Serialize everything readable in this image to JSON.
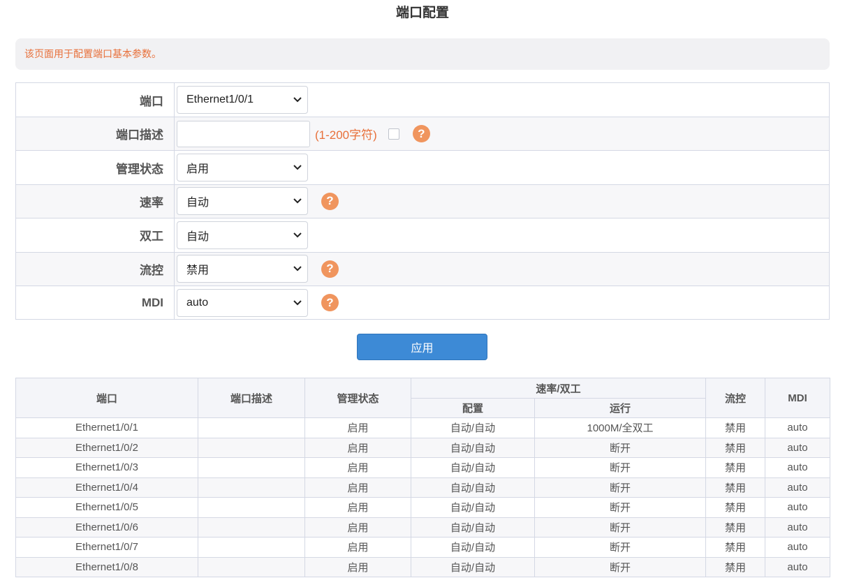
{
  "page": {
    "title": "端口配置",
    "notice": "该页面用于配置端口基本参数。"
  },
  "form": {
    "port": {
      "label": "端口",
      "value": "Ethernet1/0/1"
    },
    "description": {
      "label": "端口描述",
      "value": "",
      "hint": "(1-200字符)"
    },
    "admin_status": {
      "label": "管理状态",
      "value": "启用"
    },
    "speed": {
      "label": "速率",
      "value": "自动"
    },
    "duplex": {
      "label": "双工",
      "value": "自动"
    },
    "flow_control": {
      "label": "流控",
      "value": "禁用"
    },
    "mdi": {
      "label": "MDI",
      "value": "auto"
    },
    "help_glyph": "?",
    "apply_label": "应用"
  },
  "table": {
    "headers": {
      "port": "端口",
      "description": "端口描述",
      "admin_status": "管理状态",
      "speed_duplex": "速率/双工",
      "config": "配置",
      "running": "运行",
      "flow_control": "流控",
      "mdi": "MDI"
    },
    "rows": [
      {
        "port": "Ethernet1/0/1",
        "description": "",
        "admin_status": "启用",
        "config": "自动/自动",
        "running": "1000M/全双工",
        "flow_control": "禁用",
        "mdi": "auto"
      },
      {
        "port": "Ethernet1/0/2",
        "description": "",
        "admin_status": "启用",
        "config": "自动/自动",
        "running": "断开",
        "flow_control": "禁用",
        "mdi": "auto"
      },
      {
        "port": "Ethernet1/0/3",
        "description": "",
        "admin_status": "启用",
        "config": "自动/自动",
        "running": "断开",
        "flow_control": "禁用",
        "mdi": "auto"
      },
      {
        "port": "Ethernet1/0/4",
        "description": "",
        "admin_status": "启用",
        "config": "自动/自动",
        "running": "断开",
        "flow_control": "禁用",
        "mdi": "auto"
      },
      {
        "port": "Ethernet1/0/5",
        "description": "",
        "admin_status": "启用",
        "config": "自动/自动",
        "running": "断开",
        "flow_control": "禁用",
        "mdi": "auto"
      },
      {
        "port": "Ethernet1/0/6",
        "description": "",
        "admin_status": "启用",
        "config": "自动/自动",
        "running": "断开",
        "flow_control": "禁用",
        "mdi": "auto"
      },
      {
        "port": "Ethernet1/0/7",
        "description": "",
        "admin_status": "启用",
        "config": "自动/自动",
        "running": "断开",
        "flow_control": "禁用",
        "mdi": "auto"
      },
      {
        "port": "Ethernet1/0/8",
        "description": "",
        "admin_status": "启用",
        "config": "自动/自动",
        "running": "断开",
        "flow_control": "禁用",
        "mdi": "auto"
      }
    ]
  },
  "colors": {
    "accent": "#3d8ad6",
    "hint": "#e8703a",
    "help_icon": "#f0955e"
  }
}
